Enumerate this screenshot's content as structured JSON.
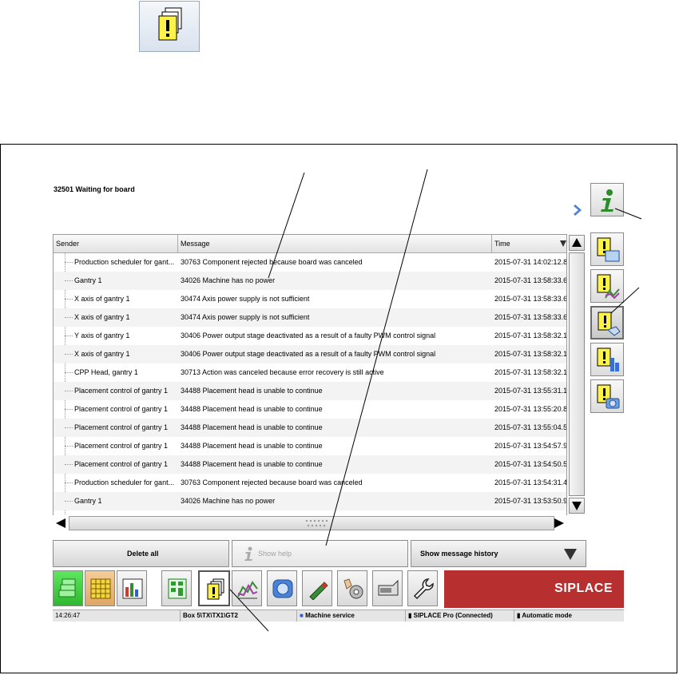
{
  "status": {
    "title": "32501 Waiting for board"
  },
  "table": {
    "headers": {
      "sender": "Sender",
      "message": "Message",
      "time": "Time"
    },
    "rows": [
      {
        "sender": "Production scheduler for gant...",
        "message": "30763 Component rejected because board was canceled",
        "time": "2015-07-31 14:02:12.8"
      },
      {
        "sender": "Gantry 1",
        "message": "34026 Machine has no power",
        "time": "2015-07-31 13:58:33.6"
      },
      {
        "sender": "X axis of gantry 1",
        "message": "30474 Axis power supply is not sufficient",
        "time": "2015-07-31 13:58:33.6"
      },
      {
        "sender": "X axis of gantry 1",
        "message": "30474 Axis power supply is not sufficient",
        "time": "2015-07-31 13:58:33.6"
      },
      {
        "sender": "Y axis of gantry 1",
        "message": "30406 Power output stage deactivated as a result of a faulty PWM control signal",
        "time": "2015-07-31 13:58:32.1"
      },
      {
        "sender": "X axis of gantry 1",
        "message": "30406 Power output stage deactivated as a result of a faulty PWM control signal",
        "time": "2015-07-31 13:58:32.1"
      },
      {
        "sender": "CPP Head, gantry 1",
        "message": "30713 Action was canceled because error recovery is still active",
        "time": "2015-07-31 13:58:32.1"
      },
      {
        "sender": "Placement control of gantry 1",
        "message": "34488 Placement head is unable to continue",
        "time": "2015-07-31 13:55:31.1"
      },
      {
        "sender": "Placement control of gantry 1",
        "message": "34488 Placement head is unable to continue",
        "time": "2015-07-31 13:55:20.8"
      },
      {
        "sender": "Placement control of gantry 1",
        "message": "34488 Placement head is unable to continue",
        "time": "2015-07-31 13:55:04.5"
      },
      {
        "sender": "Placement control of gantry 1",
        "message": "34488 Placement head is unable to continue",
        "time": "2015-07-31 13:54:57.9"
      },
      {
        "sender": "Placement control of gantry 1",
        "message": "34488 Placement head is unable to continue",
        "time": "2015-07-31 13:54:50.5"
      },
      {
        "sender": "Production scheduler for gant...",
        "message": "30763 Component rejected because board was canceled",
        "time": "2015-07-31 13:54:31.4"
      },
      {
        "sender": "Gantry 1",
        "message": "34026 Machine has no power",
        "time": "2015-07-31 13:53:50.9"
      }
    ]
  },
  "actions": {
    "delete_all": "Delete all",
    "show_help": "Show help",
    "show_history": "Show message history"
  },
  "brand": {
    "name": "SIPLACE",
    "color": "#b82f2f"
  },
  "statusbar": {
    "clock": "14:26:47",
    "station": "Box 5\\TX\\TX1\\GT2",
    "user": "Machine service",
    "connection": "SIPLACE Pro (Connected)",
    "mode": "Automatic mode"
  },
  "icons": {
    "top": "message-stack-icon",
    "sidebar": [
      "info-icon",
      "message-screen-icon",
      "message-chart-icon",
      "message-hand-icon",
      "message-bars-icon",
      "message-camera-icon"
    ],
    "toolbar": [
      "green-stack-icon",
      "grid-icon",
      "bar-chart-icon",
      "board-layout-icon",
      "messages-icon",
      "line-chart-icon",
      "camera-icon",
      "nozzle-icon",
      "service-icon",
      "feeder-icon",
      "wrench-icon"
    ]
  }
}
